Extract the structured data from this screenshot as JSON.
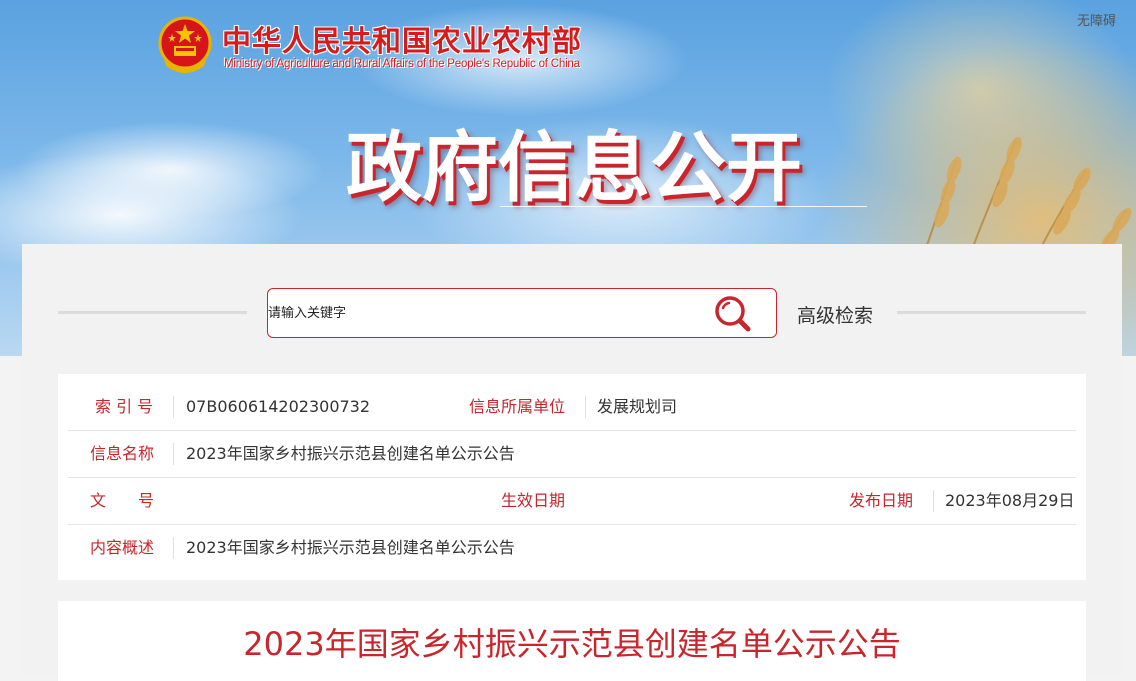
{
  "header": {
    "ministry_cn": "中华人民共和国农业农村部",
    "ministry_en": "Ministry of Agriculture and Rural Affairs of the People's Republic of China",
    "accessibility": "无障碍",
    "title": "政府信息公开",
    "emblem_icon": "national-emblem-icon"
  },
  "search": {
    "placeholder": "请输入关键字",
    "button_icon": "search-icon",
    "advanced": "高级检索"
  },
  "info": {
    "index_label": "索 引 号",
    "index_value": "07B060614202300732",
    "unit_label": "信息所属单位",
    "unit_value": "发展规划司",
    "name_label": "信息名称",
    "name_value": "2023年国家乡村振兴示范县创建名单公示公告",
    "docno_label": "文　　号",
    "docno_value": "",
    "effective_label": "生效日期",
    "effective_value": "",
    "publish_label": "发布日期",
    "publish_value": "2023年08月29日",
    "summary_label": "内容概述",
    "summary_value": "2023年国家乡村振兴示范县创建名单公示公告"
  },
  "article": {
    "title": "2023年国家乡村振兴示范县创建名单公示公告"
  },
  "colors": {
    "accent": "#c9252c",
    "sky": "#7db8ea"
  }
}
